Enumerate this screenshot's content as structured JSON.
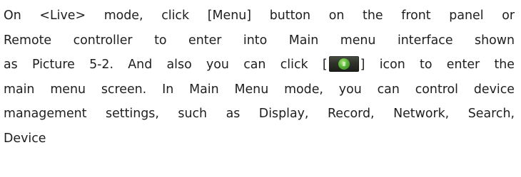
{
  "paragraph": {
    "line1": "On <Live> mode, click [Menu] button on the front panel or",
    "line2": "Remote controller to enter into Main menu interface shown",
    "line3_before_icon": "as Picture 5-2. And also you can click [",
    "line3_after_icon": "] icon to enter the",
    "line4": "main menu screen. In Main Menu mode, you can control device",
    "line5": "management settings, such as Display, Record, Network, Search,",
    "line6": "Device"
  },
  "icons": {
    "menu_icon": "main-menu-icon"
  }
}
